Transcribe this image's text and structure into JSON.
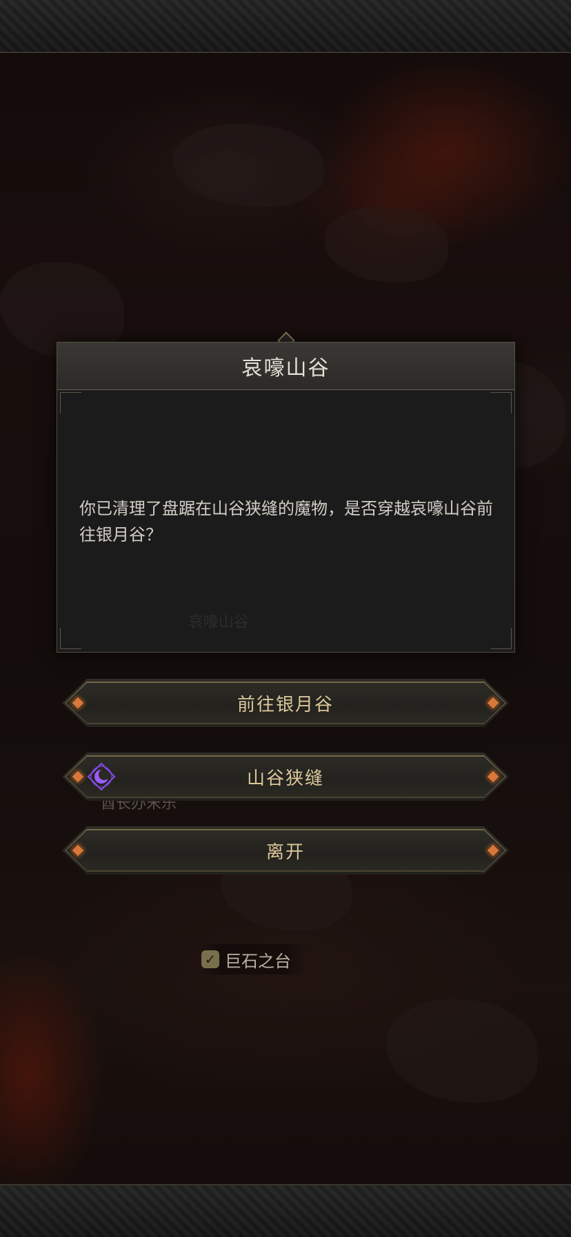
{
  "dialog": {
    "title": "哀嚎山谷",
    "message": "你已清理了盘踞在山谷狭缝的魔物，是否穿越哀嚎山谷前往银月谷？",
    "ghost_text": "哀嚎山谷"
  },
  "options": [
    {
      "label": "前往银月谷",
      "icon": null
    },
    {
      "label": "山谷狭缝",
      "icon": "crescent-moon-icon"
    },
    {
      "label": "离开",
      "icon": null
    }
  ],
  "map": {
    "landmark_label": "巨石之台",
    "landmark_icon": "checkmark-icon",
    "faded_label": "酋长办宋乐"
  },
  "colors": {
    "option_text": "#dcc79a",
    "gem_accent": "#d7773a",
    "moon_icon": "#9b5cff"
  }
}
